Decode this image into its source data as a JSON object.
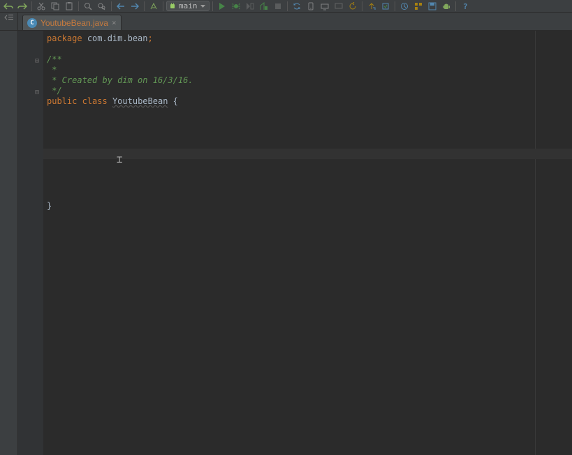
{
  "toolbar": {
    "run_config": "main"
  },
  "tabs": [
    {
      "icon": "C",
      "label": "YoutubeBean.java"
    }
  ],
  "code": {
    "package_kw": "package",
    "package_name": "com.dim.bean",
    "semicolon": ";",
    "comment_open": "/**",
    "comment_mid": " *",
    "comment_body": " * Created by dim on 16/3/16.",
    "comment_close": " */",
    "public_kw": "public",
    "class_kw": "class",
    "class_name": "YoutubeBean",
    "brace_open": " {",
    "brace_close": "}"
  }
}
